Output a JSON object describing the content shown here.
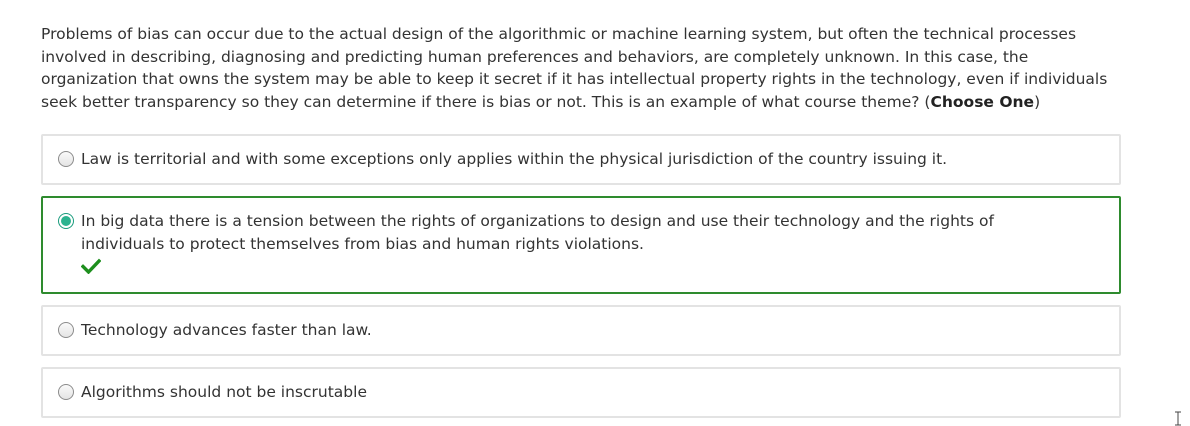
{
  "question": {
    "text": "Problems of bias can occur due to the actual design of the algorithmic or machine learning system, but often the technical processes involved in describing, diagnosing and predicting human preferences and behaviors, are completely unknown. In this case, the organization that owns the system may be able to keep it secret if it has intellectual property rights in the technology, even if individuals seek better transparency so they can determine if there is bias or not. This is an example of what course theme? (",
    "instruction": "Choose One",
    "closing": ")"
  },
  "options": [
    {
      "label": "Law is territorial and with some exceptions only applies within the physical jurisdiction of the country issuing it.",
      "selected": false,
      "correct": false
    },
    {
      "label": "In big data there is a tension between the rights of organizations to design and use their technology and the rights of individuals to protect themselves from bias and human rights violations.",
      "selected": true,
      "correct": true
    },
    {
      "label": "Technology advances faster than law.",
      "selected": false,
      "correct": false
    },
    {
      "label": "Algorithms should not be inscrutable",
      "selected": false,
      "correct": false
    }
  ],
  "icons": {
    "correct": "checkmark-icon",
    "cursor": "text-cursor-icon"
  },
  "colors": {
    "correct_border": "#2e8b2e",
    "checkmark": "#1e8f1e",
    "radio_selected": "#2bb38f",
    "option_border": "#e3e3e3",
    "text": "#333333"
  }
}
